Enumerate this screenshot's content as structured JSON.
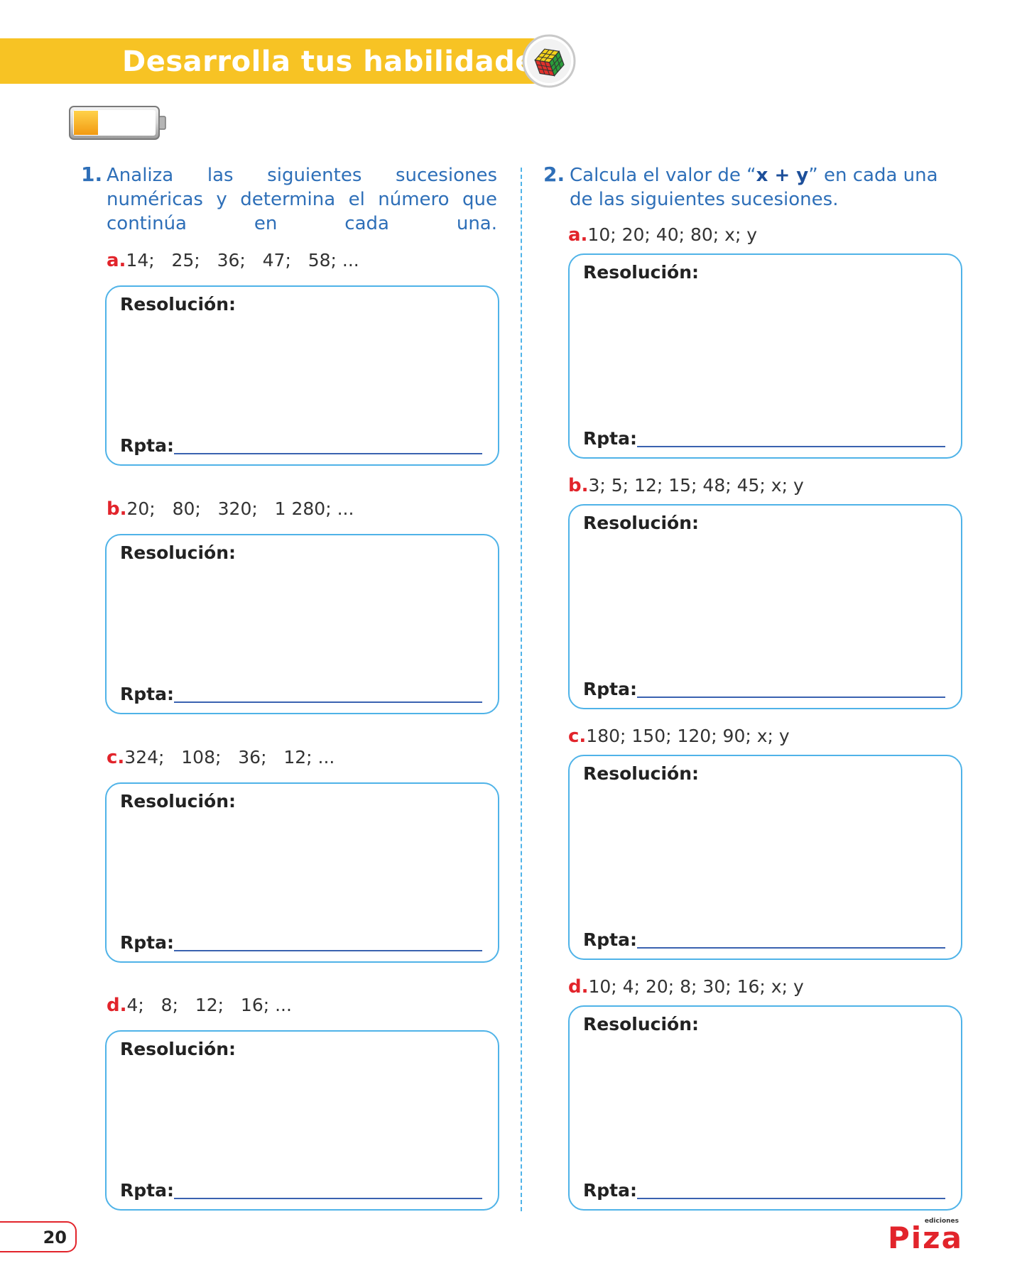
{
  "header": {
    "title": "Desarrolla tus habilidades",
    "icon": "rubiks-cube-icon",
    "accent_color": "#f7c324"
  },
  "question1": {
    "number": "1.",
    "text": "Analiza las siguientes sucesiones numéricas y determina el número que continúa en cada una.",
    "items": [
      {
        "letter": "a.",
        "sequence": "14;   25;   36;   47;   58; ..."
      },
      {
        "letter": "b.",
        "sequence": "20;   80;   320;   1 280; ..."
      },
      {
        "letter": "c.",
        "sequence": "324;   108;   36;   12; ..."
      },
      {
        "letter": "d.",
        "sequence": "4;   8;   12;   16; ..."
      }
    ]
  },
  "question2": {
    "number": "2.",
    "text_before": "Calcula el valor de “",
    "text_bold": "x + y",
    "text_after": "” en cada una de las siguientes sucesiones.",
    "items": [
      {
        "letter": "a.",
        "sequence": "10; 20; 40; 80; x; y"
      },
      {
        "letter": "b.",
        "sequence": "3; 5; 12; 15; 48; 45; x; y"
      },
      {
        "letter": "c.",
        "sequence": "180; 150; 120; 90; x; y"
      },
      {
        "letter": "d.",
        "sequence": "10; 4; 20; 8; 30; 16; x; y"
      }
    ]
  },
  "box_labels": {
    "resolution": "Resolución:",
    "answer": "Rpta:"
  },
  "footer": {
    "page_number": "20",
    "brand_small": "ediciones",
    "brand": "Piza"
  }
}
